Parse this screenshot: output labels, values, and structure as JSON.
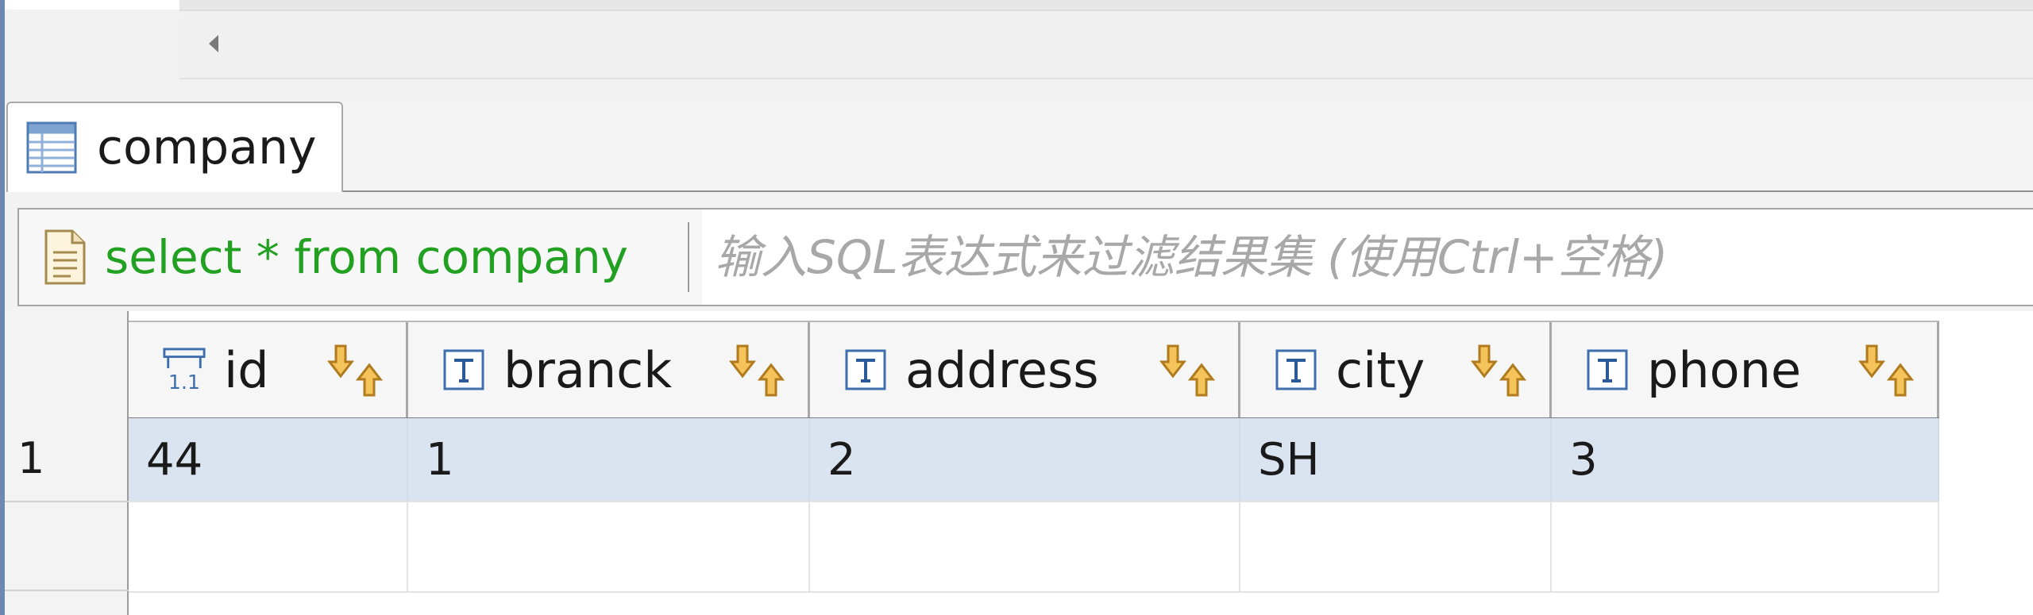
{
  "tab": {
    "label": "company",
    "icon": "table-icon"
  },
  "filter": {
    "sql": "select * from company",
    "placeholder": "输入SQL表达式来过滤结果集 (使用Ctrl+空格)",
    "sql_color": "#22a022"
  },
  "columns": [
    {
      "name": "id",
      "type_icon": "numeric-type-icon"
    },
    {
      "name": "branck",
      "type_icon": "text-type-icon"
    },
    {
      "name": "address",
      "type_icon": "text-type-icon"
    },
    {
      "name": "city",
      "type_icon": "text-type-icon"
    },
    {
      "name": "phone",
      "type_icon": "text-type-icon"
    }
  ],
  "rows": [
    {
      "num": "1",
      "cells": [
        "44",
        "1",
        "2",
        "SH",
        "3"
      ]
    }
  ],
  "colors": {
    "selected_row": "#dae4f0",
    "accent_border": "#6b89b0"
  }
}
